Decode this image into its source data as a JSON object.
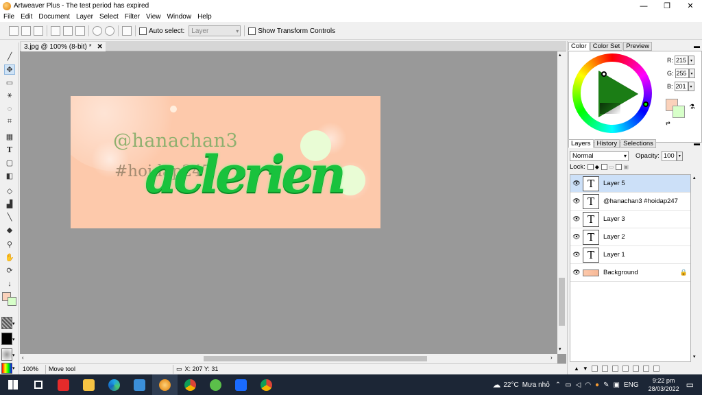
{
  "window": {
    "title": "Artweaver Plus - The test period has expired",
    "controls": {
      "minimize": "—",
      "maximize": "❐",
      "close": "✕"
    }
  },
  "menu": [
    "File",
    "Edit",
    "Document",
    "Layer",
    "Select",
    "Filter",
    "View",
    "Window",
    "Help"
  ],
  "toolbar": {
    "auto_select_label": "Auto select:",
    "auto_select_value": "Layer",
    "show_transform_label": "Show Transform Controls"
  },
  "tools": [
    "brush-tool",
    "move-tool",
    "rectangle-select-tool",
    "magic-wand-tool",
    "lasso-tool",
    "crop-tool",
    "perspective-tool",
    "text-tool",
    "shape-tool",
    "gradient-tool",
    "eraser-tool",
    "stamp-tool",
    "eyedropper-tool",
    "fill-tool",
    "zoom-tool",
    "hand-tool",
    "rotate-tool",
    "arrow-tool"
  ],
  "document": {
    "tab_title": "3.jpg @ 100% (8-bit) *",
    "close_glyph": "✕",
    "image_text_handle": "@hanachan3",
    "image_text_hashtag": "#hoidap247",
    "image_text_script": "aclerien"
  },
  "status": {
    "zoom": "100%",
    "tool": "Move tool",
    "coords": "X: 207  Y: 31"
  },
  "color_panel": {
    "tabs": [
      "Color",
      "Color Set",
      "Preview"
    ],
    "r_label": "R:",
    "r": "215",
    "g_label": "G:",
    "g": "255",
    "b_label": "B:",
    "b": "201",
    "fg_color": "#fbd2bb",
    "bg_color": "#d7ffc9"
  },
  "layers_panel": {
    "tabs": [
      "Layers",
      "History",
      "Selections"
    ],
    "blend_mode": "Normal",
    "opacity_label": "Opacity:",
    "opacity": "100",
    "lock_label": "Lock:",
    "layers": [
      {
        "name": "Layer 5",
        "type": "text",
        "selected": true
      },
      {
        "name": "@hanachan3 #hoidap247",
        "type": "text",
        "selected": false
      },
      {
        "name": "Layer 3",
        "type": "text",
        "selected": false
      },
      {
        "name": "Layer 2",
        "type": "text",
        "selected": false
      },
      {
        "name": "Layer 1",
        "type": "text",
        "selected": false
      },
      {
        "name": "Background",
        "type": "image",
        "selected": false
      }
    ],
    "text_layer_glyph": "T"
  },
  "taskbar": {
    "weather_temp": "22°C",
    "weather_desc": "Mưa nhỏ",
    "language": "ENG",
    "time": "9:22 pm",
    "date": "28/03/2022"
  }
}
